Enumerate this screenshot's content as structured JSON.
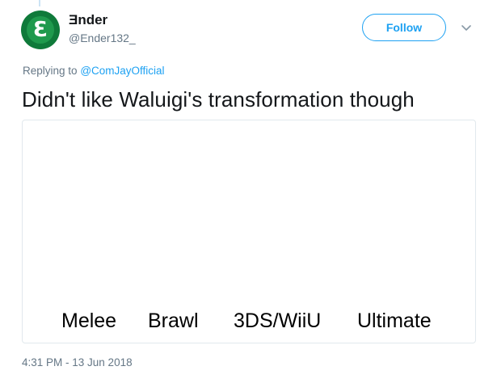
{
  "author": {
    "display_name": "Ǝnder",
    "handle": "@Ender132_",
    "avatar_letter": "Ɛ",
    "avatar_colors": {
      "outer": "#0f7a3a",
      "inner": "#1f9a4d"
    }
  },
  "actions": {
    "follow_label": "Follow",
    "caret_icon": "chevron-down-icon"
  },
  "reply": {
    "prefix": "Replying to",
    "mention": "@ComJayOfficial"
  },
  "tweet": {
    "text": "Didn't like Waluigi's transformation though"
  },
  "media": {
    "labels": [
      "Melee",
      "Brawl",
      "3DS/WiiU",
      "Ultimate"
    ]
  },
  "meta": {
    "timestamp": "4:31 PM - 13 Jun 2018"
  },
  "colors": {
    "accent": "#1da1f2",
    "secondary_text": "#657786",
    "primary_text": "#14171a",
    "border": "#e1e8ed"
  }
}
